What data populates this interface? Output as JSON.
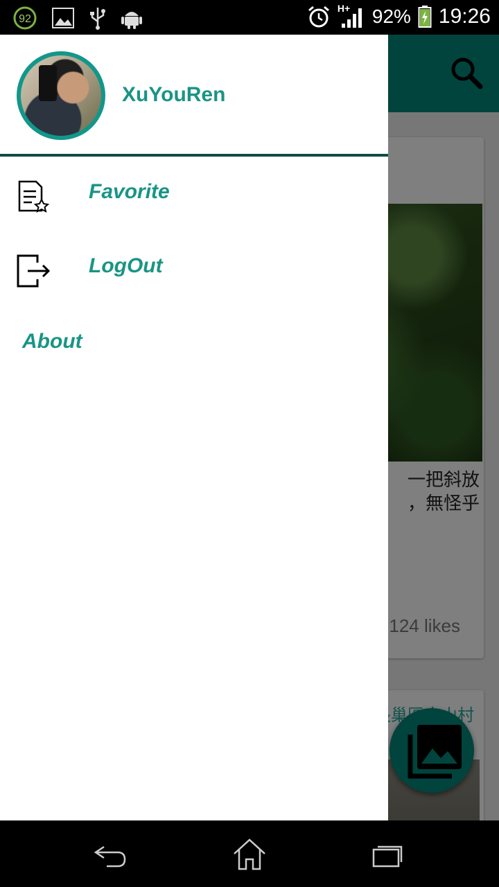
{
  "status_bar": {
    "notification_badge": "92",
    "battery_percent": "92%",
    "time": "19:26",
    "network": "H+",
    "icons": [
      "badge-92-icon",
      "image-icon",
      "usb-icon",
      "android-icon",
      "alarm-icon",
      "signal-icon",
      "battery-icon"
    ]
  },
  "background_feed": {
    "caption_line1": "一把斜放",
    "caption_line2": "，無怪乎",
    "likes": "124 likes",
    "card2_title": "長巢區金山村"
  },
  "drawer": {
    "user": {
      "name": "XuYouRen"
    },
    "items": [
      {
        "label": "Favorite",
        "icon": "favorite-document-icon"
      },
      {
        "label": "LogOut",
        "icon": "logout-icon"
      }
    ],
    "about_label": "About"
  },
  "colors": {
    "accent": "#1a9485",
    "appbar": "#00897b",
    "header_divider": "#0d4d45"
  }
}
